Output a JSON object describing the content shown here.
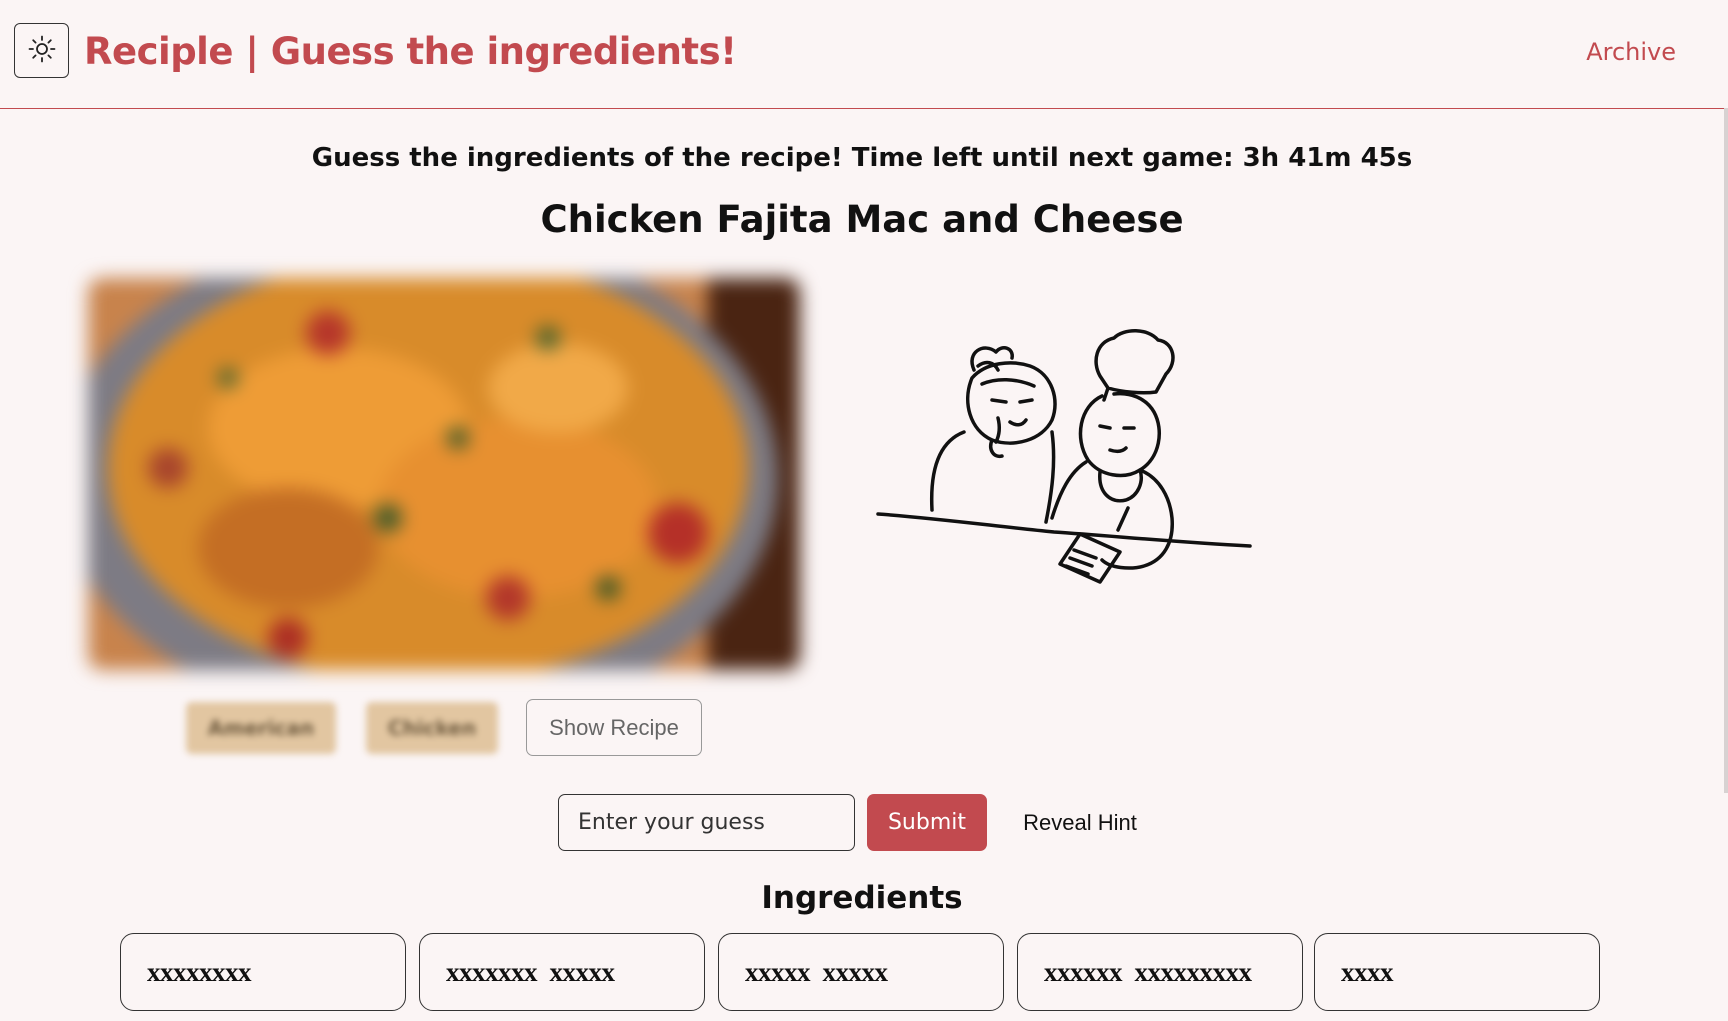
{
  "header": {
    "theme_toggle_icon": "sun-icon",
    "brand": "Reciple | Guess the ingredients!",
    "archive_link": "Archive",
    "accent_color": "#c24a4f"
  },
  "game": {
    "subtitle": "Guess the ingredients of the recipe! Time left until next game: 3h 41m 45s",
    "recipe_title": "Chicken Fajita Mac and Cheese",
    "photo_icon": "blurred-dish-photo",
    "illustration_icon": "grandma-and-chef-drawing"
  },
  "tags": [
    {
      "label": "American",
      "blurred": true
    },
    {
      "label": "Chicken",
      "blurred": true
    }
  ],
  "show_recipe_label": "Show Recipe",
  "guess": {
    "placeholder": "Enter your guess",
    "value": "",
    "submit_label": "Submit",
    "hint_label": "Reveal Hint"
  },
  "ingredients": {
    "heading": "Ingredients",
    "items": [
      {
        "masked": "xxxxxxxx"
      },
      {
        "masked": "xxxxxxx  xxxxx"
      },
      {
        "masked": "xxxxx  xxxxx"
      },
      {
        "masked": "xxxxxx  xxxxxxxxx"
      },
      {
        "masked": "xxxx"
      }
    ]
  }
}
